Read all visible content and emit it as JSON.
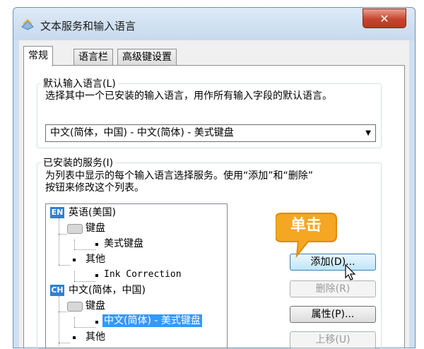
{
  "window": {
    "title": "文本服务和输入语言",
    "close_label": "✕"
  },
  "tabs": [
    {
      "label": "常规"
    },
    {
      "label": "语言栏"
    },
    {
      "label": "高级键设置"
    }
  ],
  "default_language": {
    "group_label": "默认输入语言(L)",
    "description": "选择其中一个已安装的输入语言，用作所有输入字段的默认语言。",
    "selected_value": "中文(简体，中国) - 中文(简体) - 美式键盘"
  },
  "installed_services": {
    "group_label": "已安装的服务(I)",
    "description_line1": "为列表中显示的每个输入语言选择服务。使用“添加”和“删除”",
    "description_line2": "按钮来修改这个列表。",
    "tree": {
      "en_badge": "EN",
      "en_language": "英语(美国)",
      "en_keyboard": "键盘",
      "en_keyboard_item": "美式键盘",
      "en_other": "其他",
      "en_other_item": "Ink Correction",
      "ch_badge": "CH",
      "ch_language": "中文(简体，中国)",
      "ch_keyboard": "键盘",
      "ch_keyboard_item": "中文(简体) - 美式键盘",
      "ch_other": "其他"
    }
  },
  "buttons": {
    "add": "添加(D)...",
    "remove": "删除(R)",
    "properties": "属性(P)...",
    "move_up": "上移(U)"
  },
  "annotation": {
    "callout_text": "单击"
  },
  "colors": {
    "callout_fill": "#f5a623",
    "selection": "#3399ff",
    "language_badge": "#2f7fd2"
  }
}
